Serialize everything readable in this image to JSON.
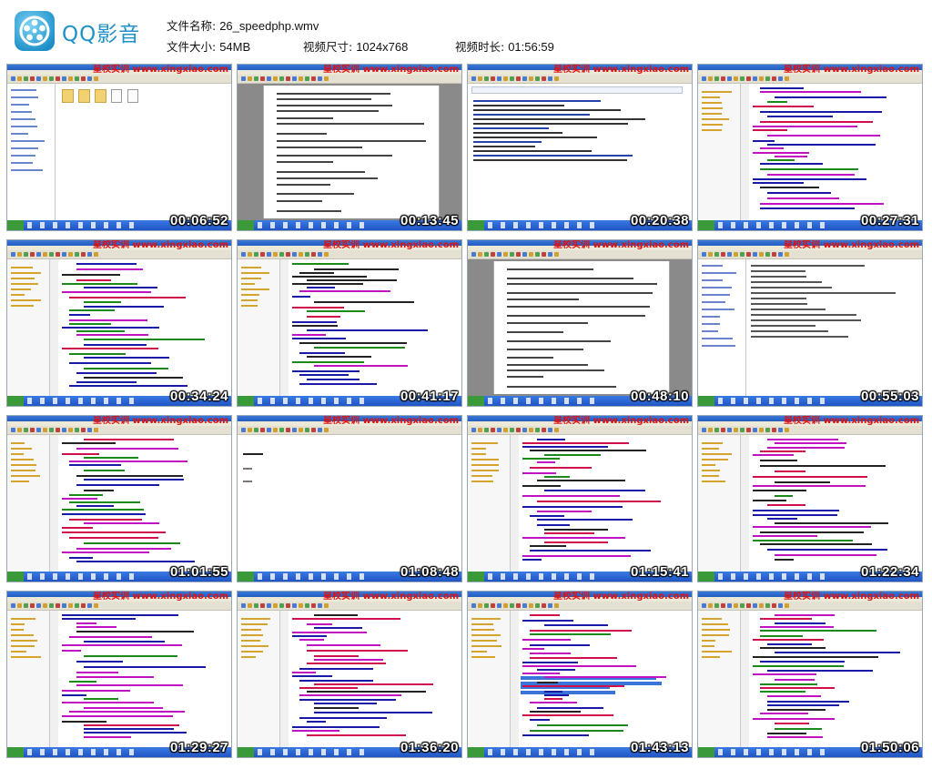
{
  "app": {
    "name": "QQ影音"
  },
  "file_info": {
    "name_label": "文件名称:",
    "name_value": "26_speedphp.wmv",
    "size_label": "文件大小:",
    "size_value": "54MB",
    "dims_label": "视频尺寸:",
    "dims_value": "1024x768",
    "duration_label": "视频时长:",
    "duration_value": "01:56:59"
  },
  "watermark": "星校实训 www.xingxiao.com",
  "thumbnails": [
    {
      "time": "00:06:52",
      "kind": "explorer"
    },
    {
      "time": "00:13:45",
      "kind": "word"
    },
    {
      "time": "00:20:38",
      "kind": "browser"
    },
    {
      "time": "00:27:31",
      "kind": "code"
    },
    {
      "time": "00:34:24",
      "kind": "code"
    },
    {
      "time": "00:41:17",
      "kind": "code"
    },
    {
      "time": "00:48:10",
      "kind": "word"
    },
    {
      "time": "00:55:03",
      "kind": "explorer2"
    },
    {
      "time": "01:01:55",
      "kind": "code"
    },
    {
      "time": "01:08:48",
      "kind": "blank"
    },
    {
      "time": "01:15:41",
      "kind": "code"
    },
    {
      "time": "01:22:34",
      "kind": "code"
    },
    {
      "time": "01:29:27",
      "kind": "code"
    },
    {
      "time": "01:36:20",
      "kind": "code"
    },
    {
      "time": "01:43:13",
      "kind": "codesel"
    },
    {
      "time": "01:50:06",
      "kind": "code"
    }
  ]
}
